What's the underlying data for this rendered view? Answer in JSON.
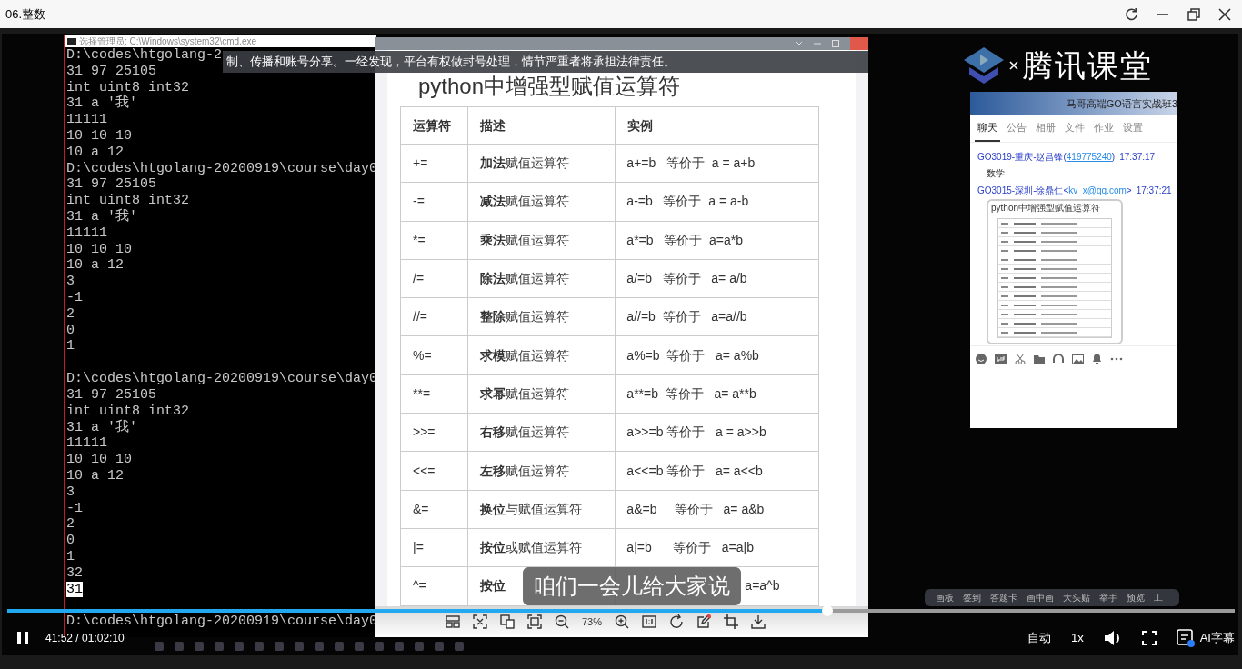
{
  "window": {
    "title": "06.整数"
  },
  "terminal": {
    "title": "选择管理员: C:\\Windows\\system32\\cmd.exe",
    "blocks": [
      {
        "lines": [
          {
            "text": "D:\\codes\\htgolang-2",
            "highlighted": false
          },
          {
            "text": "31 97 25105",
            "highlighted": false
          },
          {
            "text": "int uint8 int32",
            "highlighted": false
          },
          {
            "text": "31 a '我'",
            "highlighted": false
          },
          {
            "text": "11111",
            "highlighted": false
          },
          {
            "text": "10 10 10",
            "highlighted": false
          },
          {
            "text": "10 a 12",
            "highlighted": false
          },
          {
            "text": "D:\\codes\\htgolang-20200919\\course\\day0",
            "highlighted": false
          },
          {
            "text": "31 97 25105",
            "highlighted": false
          },
          {
            "text": "int uint8 int32",
            "highlighted": false
          },
          {
            "text": "31 a '我'",
            "highlighted": false
          },
          {
            "text": "11111",
            "highlighted": false
          },
          {
            "text": "10 10 10",
            "highlighted": false
          },
          {
            "text": "10 a 12",
            "highlighted": false
          },
          {
            "text": "3",
            "highlighted": false
          },
          {
            "text": "-1",
            "highlighted": false
          },
          {
            "text": "2",
            "highlighted": false
          },
          {
            "text": "0",
            "highlighted": false
          },
          {
            "text": "1",
            "highlighted": false
          }
        ]
      },
      {
        "lines": [
          {
            "text": "D:\\codes\\htgolang-20200919\\course\\day0",
            "highlighted": false
          },
          {
            "text": "31 97 25105",
            "highlighted": false
          },
          {
            "text": "int uint8 int32",
            "highlighted": false
          },
          {
            "text": "31 a '我'",
            "highlighted": false
          },
          {
            "text": "11111",
            "highlighted": false
          },
          {
            "text": "10 10 10",
            "highlighted": false
          },
          {
            "text": "10 a 12",
            "highlighted": false
          },
          {
            "text": "3",
            "highlighted": false
          },
          {
            "text": "-1",
            "highlighted": false
          },
          {
            "text": "2",
            "highlighted": false
          },
          {
            "text": "0",
            "highlighted": false
          },
          {
            "text": "1",
            "highlighted": false
          },
          {
            "text": "32",
            "highlighted": false
          },
          {
            "text": "31",
            "highlighted": true
          }
        ]
      },
      {
        "lines": [
          {
            "text": "D:\\codes\\htgolang-20200919\\course\\day0",
            "highlighted": false
          }
        ]
      }
    ]
  },
  "notice_banner": {
    "text": "制、传播和账号分享。一经发现，平台有权做封号处理，情节严重者将承担法律责任。"
  },
  "image_viewer": {
    "heading": "python中增强型赋值运算符",
    "table": {
      "columns": [
        "运算符",
        "描述",
        "实例"
      ],
      "rows": [
        {
          "operator": "+=",
          "description": "**加法**赋值运算符",
          "example": "a+=b   等价于  a = a+b",
          "covered": false
        },
        {
          "operator": "-=",
          "description": "**减法**赋值运算符",
          "example": "a-=b   等价于  a = a-b",
          "covered": false
        },
        {
          "operator": "*=",
          "description": "**乘法**赋值运算符",
          "example": "a*=b   等价于  a=a*b",
          "covered": false
        },
        {
          "operator": "/=",
          "description": "**除法**赋值运算符",
          "example": "a/=b   等价于   a= a/b",
          "covered": false
        },
        {
          "operator": "//=",
          "description": "**整除**赋值运算符",
          "example": "a//=b  等价于   a=a//b",
          "covered": false
        },
        {
          "operator": "%=",
          "description": "**求模**赋值运算符",
          "example": "a%=b  等价于   a= a%b",
          "covered": false
        },
        {
          "operator": "**=",
          "description": "**求幂**赋值运算符",
          "example": "a**=b  等价于   a= a**b",
          "covered": false
        },
        {
          "operator": ">>=",
          "description": "**右移**赋值运算符",
          "example": "a>>=b 等价于   a = a>>b",
          "covered": false
        },
        {
          "operator": "<<=",
          "description": "**左移**赋值运算符",
          "example": "a<<=b 等价于   a= a<<b",
          "covered": false
        },
        {
          "operator": "&=",
          "description": "**换位**与赋值运算符",
          "example": "a&=b     等价于   a= a&b",
          "covered": false
        },
        {
          "operator": "|=",
          "description": "**按位**或赋值运算符",
          "example": "a|=b      等价于   a=a|b",
          "covered": false
        },
        {
          "operator": "^=",
          "description": "**按位**",
          "example": "a=a^b",
          "covered": true
        }
      ]
    },
    "zoom": "73%"
  },
  "subtitle": "咱们一会儿给大家说",
  "logo": {
    "text": "腾讯课堂"
  },
  "chat": {
    "group_title": "马哥高端GO语言实战班3",
    "tabs": [
      {
        "label": "聊天",
        "selected": true
      },
      {
        "label": "公告",
        "selected": false
      },
      {
        "label": "相册",
        "selected": false
      },
      {
        "label": "文件",
        "selected": false
      },
      {
        "label": "作业",
        "selected": false
      },
      {
        "label": "设置",
        "selected": false
      }
    ],
    "messages": [
      {
        "kind": "text",
        "sender": "GO3019-重庆-赵昌锋(",
        "contact": "419775240",
        "suffix": ")",
        "time": "17:37:17",
        "text": "数学"
      },
      {
        "kind": "image",
        "sender": "GO3015-深圳-徐鼎仁<",
        "contact": "kv_x@qq.com",
        "suffix": ">",
        "time": "17:37:21",
        "text": "python中增强型赋值运算符"
      }
    ]
  },
  "class_tools": [
    "画板",
    "签到",
    "答题卡",
    "画中画",
    "大头贴",
    "举手",
    "预览",
    "工"
  ],
  "player": {
    "progress": {
      "level": 0.668
    },
    "time": "41:52 / 01:02:10",
    "quality": "自动",
    "speed": "1x",
    "subtitle_label": "AI字幕"
  }
}
